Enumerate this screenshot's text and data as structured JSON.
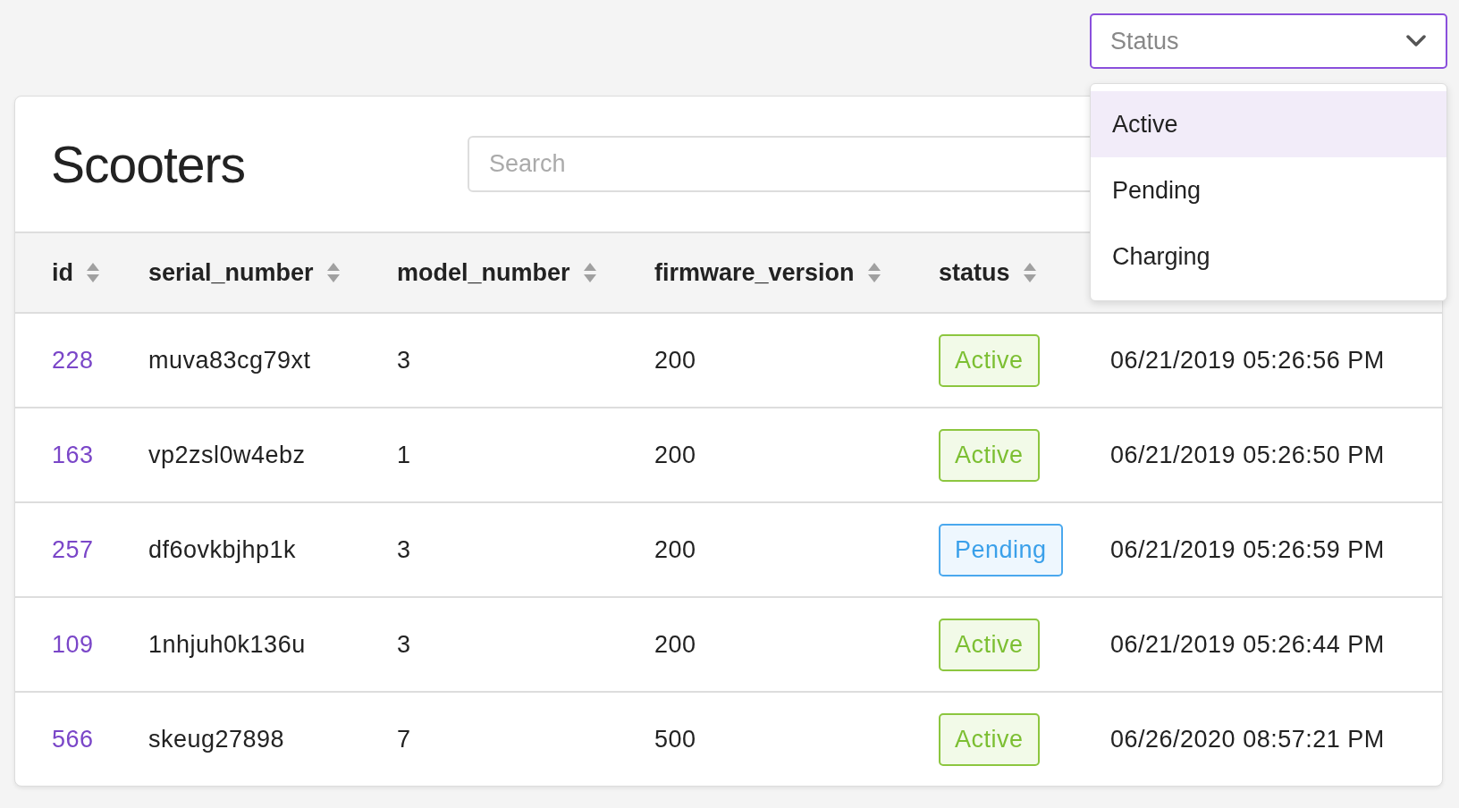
{
  "status_filter": {
    "placeholder": "Status",
    "open": true,
    "options": [
      {
        "label": "Active",
        "selected": true
      },
      {
        "label": "Pending",
        "selected": false
      },
      {
        "label": "Charging",
        "selected": false
      }
    ]
  },
  "card": {
    "title": "Scooters",
    "search": {
      "placeholder": "Search"
    }
  },
  "table": {
    "columns": [
      {
        "label": "id",
        "sortable": true
      },
      {
        "label": "serial_number",
        "sortable": true
      },
      {
        "label": "model_number",
        "sortable": true
      },
      {
        "label": "firmware_version",
        "sortable": true
      },
      {
        "label": "status",
        "sortable": true
      }
    ],
    "rows": [
      {
        "id": "228",
        "serial_number": "muva83cg79xt",
        "model_number": "3",
        "firmware_version": "200",
        "status": {
          "label": "Active",
          "kind": "active"
        },
        "column_6": "06/21/2019 05:26:56 PM"
      },
      {
        "id": "163",
        "serial_number": "vp2zsl0w4ebz",
        "model_number": "1",
        "firmware_version": "200",
        "status": {
          "label": "Active",
          "kind": "active"
        },
        "column_6": "06/21/2019 05:26:50 PM"
      },
      {
        "id": "257",
        "serial_number": "df6ovkbjhp1k",
        "model_number": "3",
        "firmware_version": "200",
        "status": {
          "label": "Pending",
          "kind": "pending"
        },
        "column_6": "06/21/2019 05:26:59 PM"
      },
      {
        "id": "109",
        "serial_number": "1nhjuh0k136u",
        "model_number": "3",
        "firmware_version": "200",
        "status": {
          "label": "Active",
          "kind": "active"
        },
        "column_6": "06/21/2019 05:26:44 PM"
      },
      {
        "id": "566",
        "serial_number": "skeug27898",
        "model_number": "7",
        "firmware_version": "500",
        "status": {
          "label": "Active",
          "kind": "active"
        },
        "column_6": "06/26/2020 08:57:21 PM"
      }
    ]
  }
}
